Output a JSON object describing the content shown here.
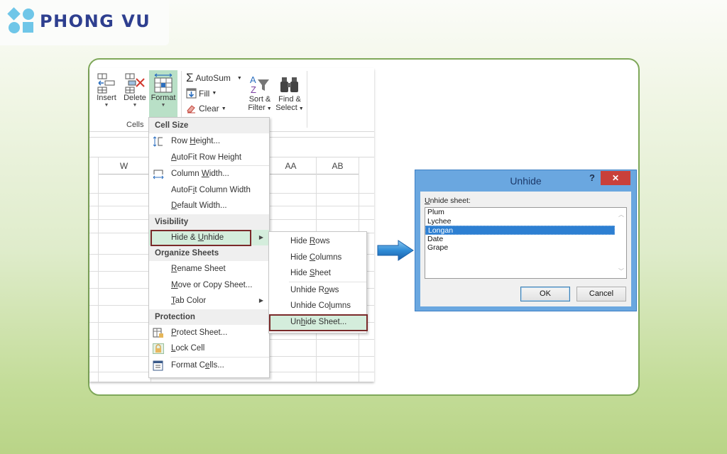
{
  "brand": {
    "name": "PHONG VU",
    "logo_icon": "phong-vu-logo-icon",
    "text_color": "#2e3f8f",
    "icon_color": "#6fc6e8"
  },
  "ribbon": {
    "cells_group_label": "Cells",
    "buttons": {
      "insert": {
        "label": "Insert",
        "icon": "insert-cells-icon"
      },
      "delete": {
        "label": "Delete",
        "icon": "delete-cells-icon"
      },
      "format": {
        "label": "Format",
        "icon": "format-cells-icon",
        "active": true
      }
    },
    "editing": {
      "autosum": {
        "label": "AutoSum",
        "icon": "sigma-icon"
      },
      "fill": {
        "label": "Fill",
        "icon": "fill-down-icon"
      },
      "clear": {
        "label": "Clear",
        "icon": "eraser-icon"
      },
      "sort_filter": {
        "label1": "Sort &",
        "label2": "Filter",
        "icon": "sort-filter-icon"
      },
      "find_select": {
        "label1": "Find &",
        "label2": "Select",
        "icon": "binoculars-icon"
      }
    }
  },
  "grid": {
    "columns": [
      "W",
      "",
      "",
      "AA",
      "AB"
    ]
  },
  "format_menu": {
    "sections": [
      {
        "header": "Cell Size",
        "items": [
          {
            "label_pre": "Row ",
            "accel": "H",
            "label_post": "eight...",
            "icon": "row-height-icon"
          },
          {
            "label_pre": "",
            "accel": "A",
            "label_post": "utoFit Row Height"
          },
          {
            "label_pre": "Column ",
            "accel": "W",
            "label_post": "idth...",
            "icon": "column-width-icon"
          },
          {
            "label_pre": "AutoF",
            "accel": "i",
            "label_post": "t Column Width"
          },
          {
            "label_pre": "",
            "accel": "D",
            "label_post": "efault Width..."
          }
        ]
      },
      {
        "header": "Visibility",
        "items": [
          {
            "label_pre": "Hide & ",
            "accel": "U",
            "label_post": "nhide",
            "submenu": true,
            "highlighted": true
          }
        ]
      },
      {
        "header": "Organize Sheets",
        "items": [
          {
            "label_pre": "",
            "accel": "R",
            "label_post": "ename Sheet"
          },
          {
            "label_pre": "",
            "accel": "M",
            "label_post": "ove or Copy Sheet..."
          },
          {
            "label_pre": "",
            "accel": "T",
            "label_post": "ab Color",
            "submenu": true
          }
        ]
      },
      {
        "header": "Protection",
        "items": [
          {
            "label_pre": "",
            "accel": "P",
            "label_post": "rotect Sheet...",
            "icon": "protect-sheet-icon"
          },
          {
            "label_pre": "",
            "accel": "L",
            "label_post": "ock Cell",
            "icon": "lock-icon"
          },
          {
            "label_pre": "Format C",
            "accel": "e",
            "label_post": "lls...",
            "icon": "format-cells-dialog-icon"
          }
        ]
      }
    ]
  },
  "hide_unhide_submenu": {
    "items": [
      {
        "label_pre": "Hide ",
        "accel": "R",
        "label_post": "ows"
      },
      {
        "label_pre": "Hide ",
        "accel": "C",
        "label_post": "olumns"
      },
      {
        "label_pre": "Hide ",
        "accel": "S",
        "label_post": "heet"
      },
      {
        "label_pre": "Unhide R",
        "accel": "o",
        "label_post": "ws"
      },
      {
        "label_pre": "Unhide Co",
        "accel": "l",
        "label_post": "umns"
      },
      {
        "label_pre": "Un",
        "accel": "h",
        "label_post": "ide Sheet...",
        "highlighted": true
      }
    ]
  },
  "arrow_icon": "right-arrow-icon",
  "unhide_dialog": {
    "title": "Unhide",
    "help": "?",
    "close": "✕",
    "list_label_accel": "U",
    "list_label_rest": "nhide sheet:",
    "sheets": [
      "Plum",
      "Lychee",
      "Longan",
      "Date",
      "Grape"
    ],
    "selected": "Longan",
    "ok_label": "OK",
    "cancel_label": "Cancel"
  },
  "colors": {
    "highlight_bg": "#d4eddc",
    "highlight_border": "#7a2a2a",
    "card_border": "#7fa85a",
    "dialog_frame": "#6aa7e0",
    "selection": "#2d7fd2"
  }
}
